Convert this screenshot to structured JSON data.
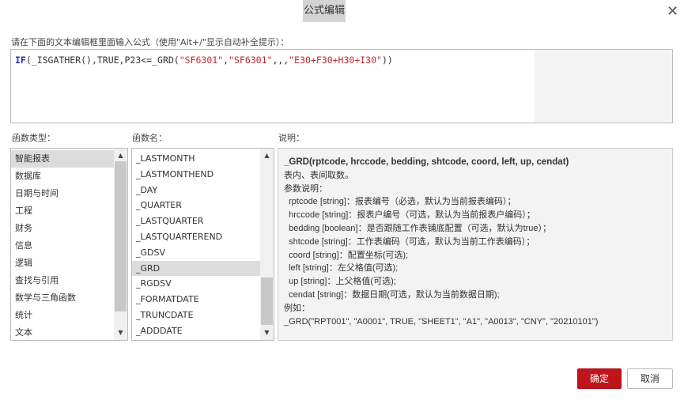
{
  "dialog": {
    "title": "公式编辑",
    "close_icon": "close-icon"
  },
  "editor": {
    "label": "请在下面的文本编辑框里面输入公式（使用\"Alt+/\"显示自动补全提示）：",
    "parts": [
      "IF",
      "(_ISGATHER(),TRUE,P23<=_GRD(",
      "\"SF6301\"",
      ",",
      "\"SF6301\"",
      ",,,",
      "\"E30+F30+H30+I30\"",
      "))"
    ]
  },
  "categories": {
    "label": "函数类型：",
    "items": [
      "智能报表",
      "数据库",
      "日期与时间",
      "工程",
      "财务",
      "信息",
      "逻辑",
      "查找与引用",
      "数学与三角函数",
      "统计",
      "文本"
    ],
    "selected": 0
  },
  "functions": {
    "label": "函数名：",
    "items": [
      "_LASTMONTH",
      "_LASTMONTHEND",
      "_DAY",
      "_QUARTER",
      "_LASTQUARTER",
      "_LASTQUARTEREND",
      "_GDSV",
      "_GRD",
      "_RGDSV",
      "_FORMATDATE",
      "_TRUNCDATE",
      "_ADDDATE"
    ],
    "selected": 7
  },
  "description": {
    "label": "说明：",
    "signature": "_GRD(rptcode, hrccode, bedding, shtcode, coord, left, up, cendat)",
    "lines": [
      "表内、表间取数。",
      "参数说明：",
      "  rptcode [string]：报表编号（必选，默认为当前报表编码）；",
      "  hrccode [string]：报表户编号（可选，默认为当前报表户编码）；",
      "  bedding [boolean]：是否跟随工作表铺底配置（可选，默认为true）；",
      "  shtcode [string]：工作表编码（可选，默认为当前工作表编码）；",
      "  coord [string]：配置坐标(可选);",
      "  left [string]：左父格值(可选);",
      "  up [string]：上父格值(可选);",
      "  cendat [string]：数据日期(可选，默认为当前数据日期);",
      "例如：",
      "_GRD(\"RPT001\", \"A0001\", TRUE, \"SHEET1\", \"A1\", \"A0013\", \"CNY\", \"20210101\")"
    ]
  },
  "buttons": {
    "ok": "确定",
    "cancel": "取消"
  },
  "colors": {
    "primary": "#c0141c"
  }
}
